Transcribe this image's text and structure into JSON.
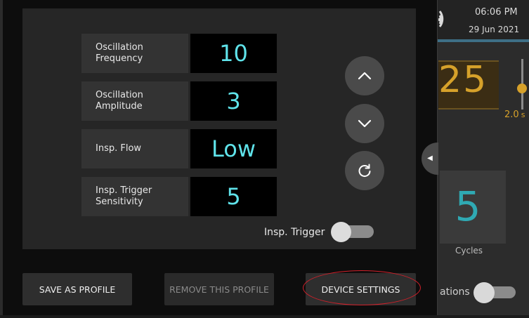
{
  "status": {
    "time": "06:06 PM",
    "date": "29 Jun 2021"
  },
  "background": {
    "big_value": "25",
    "slider_value_label": "2.0",
    "slider_unit": "s",
    "cycles_value": "5",
    "cycles_label": "Cycles",
    "partial_label": "ations",
    "toggle_on": false
  },
  "settings": [
    {
      "label": "Oscillation\nFrequency",
      "value": "10"
    },
    {
      "label": "Oscillation\nAmplitude",
      "value": "3"
    },
    {
      "label": "Insp. Flow",
      "value": "Low"
    },
    {
      "label": "Insp. Trigger\nSensitivity",
      "value": "5"
    }
  ],
  "controls": {
    "up_icon": "chevron-up-icon",
    "down_icon": "chevron-down-icon",
    "reset_icon": "refresh-icon"
  },
  "trigger": {
    "label": "Insp. Trigger",
    "on": false
  },
  "footer": {
    "save_profile": "SAVE AS PROFILE",
    "remove_profile": "REMOVE THIS PROFILE",
    "device_settings": "DEVICE SETTINGS"
  },
  "colors": {
    "value_text": "#5fe3ea",
    "accent_amber": "#d6a12a",
    "accent_teal": "#2fa9b3",
    "highlight": "#d2202a"
  }
}
